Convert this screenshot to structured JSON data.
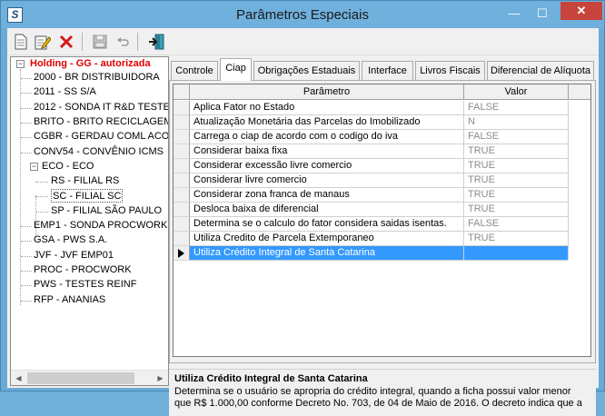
{
  "window": {
    "title": "Parâmetros Especiais",
    "close_symbol": "✕",
    "minimize_symbol": "—",
    "maximize_symbol": "☐"
  },
  "toolbar": {
    "buttons": [
      {
        "name": "new-button",
        "icon": "new-document-icon"
      },
      {
        "name": "edit-button",
        "icon": "edit-pencil-icon"
      },
      {
        "name": "delete-button",
        "icon": "red-x-icon"
      },
      {
        "name": "save-button",
        "icon": "floppy-disk-icon"
      },
      {
        "name": "undo-button",
        "icon": "undo-arrow-icon"
      },
      {
        "name": "exit-button",
        "icon": "exit-door-icon"
      }
    ]
  },
  "tree": {
    "root": "Holding -  GG -  autorizada",
    "items": [
      {
        "label": "2000 - BR DISTRIBUIDORA",
        "level": 1
      },
      {
        "label": "2011 - SS S/A",
        "level": 1
      },
      {
        "label": "2012 - SONDA IT R&D TESTE",
        "level": 1
      },
      {
        "label": "BRITO - BRITO RECICLAGEM",
        "level": 1
      },
      {
        "label": "CGBR - GERDAU  COML ACO",
        "level": 1
      },
      {
        "label": "CONV54 - CONVÊNIO ICMS",
        "level": 1
      },
      {
        "label": "ECO - ECO",
        "level": 1,
        "expanded": true
      },
      {
        "label": "RS - FILIAL RS",
        "level": 2
      },
      {
        "label": "SC - FILIAL SC",
        "level": 2,
        "selected": true
      },
      {
        "label": "SP - FILIAL SÃO PAULO",
        "level": 2
      },
      {
        "label": "EMP1 - SONDA PROCWORK",
        "level": 1
      },
      {
        "label": "GSA - PWS S.A.",
        "level": 1
      },
      {
        "label": "JVF - JVF  EMP01",
        "level": 1
      },
      {
        "label": "PROC - PROCWORK",
        "level": 1
      },
      {
        "label": "PWS - TESTES REINF",
        "level": 1
      },
      {
        "label": "RFP - ANANIAS",
        "level": 1
      }
    ]
  },
  "tabs": [
    {
      "label": "Controle",
      "active": false
    },
    {
      "label": "Ciap",
      "active": true
    },
    {
      "label": "Obrigações Estaduais",
      "active": false
    },
    {
      "label": "Interface",
      "active": false
    },
    {
      "label": "Livros Fiscais",
      "active": false
    },
    {
      "label": "Diferencial de Alíquota",
      "active": false
    }
  ],
  "grid": {
    "columns": [
      "Parâmetro",
      "Valor"
    ],
    "rows": [
      {
        "param": "Aplica Fator no Estado",
        "valor": "FALSE"
      },
      {
        "param": "Atualização Monetária das Parcelas do Imobilizado",
        "valor": "N"
      },
      {
        "param": "Carrega o ciap de acordo com o codigo do iva",
        "valor": "FALSE"
      },
      {
        "param": "Considerar baixa fixa",
        "valor": "TRUE"
      },
      {
        "param": "Considerar excessão livre comercio",
        "valor": "TRUE"
      },
      {
        "param": "Considerar livre comercio",
        "valor": "TRUE"
      },
      {
        "param": "Considerar zona franca de manaus",
        "valor": "TRUE"
      },
      {
        "param": "Desloca baixa de diferencial",
        "valor": "TRUE"
      },
      {
        "param": "Determina se o calculo do fator considera saidas isentas.",
        "valor": "FALSE"
      },
      {
        "param": "Utiliza Credito de Parcela Extemporaneo",
        "valor": "TRUE"
      },
      {
        "param": "Utiliza Crédito Integral de Santa Catarina",
        "valor": "",
        "selected": true
      }
    ]
  },
  "description": {
    "title": "Utiliza Crédito Integral de Santa Catarina",
    "text": "Determina se o usuário se apropria do crédito integral, quando a ficha possui valor menor que R$ 1.000,00 conforme Decreto No. 703, de 04 de Maio de 2016. O decreto indica que a"
  }
}
